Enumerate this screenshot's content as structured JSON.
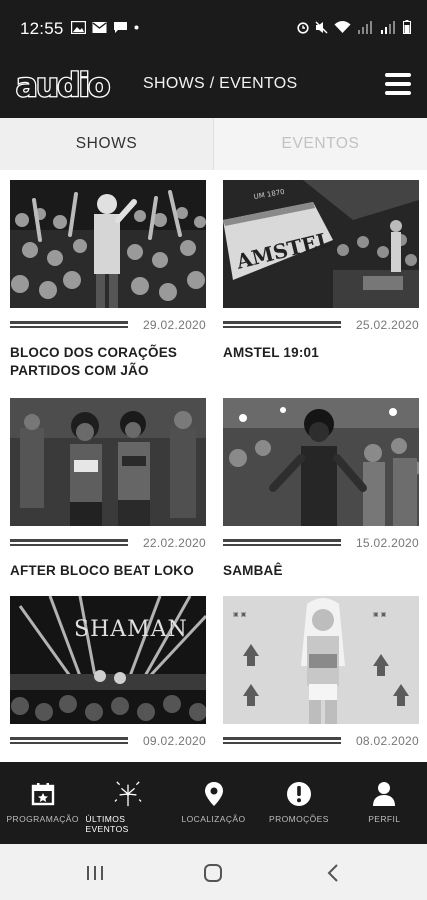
{
  "status_bar": {
    "time": "12:55"
  },
  "header": {
    "logo": "audio",
    "title": "SHOWS / EVENTOS"
  },
  "tabs": [
    {
      "label": "SHOWS",
      "active": true
    },
    {
      "label": "EVENTOS",
      "active": false
    }
  ],
  "cards": [
    {
      "date": "29.02.2020",
      "title": "BLOCO DOS CORAÇÕES PARTIDOS COM JÃO"
    },
    {
      "date": "25.02.2020",
      "title": "AMSTEL 19:01",
      "image_text": {
        "brand": "AMSTEL",
        "sign": "UM 1870"
      }
    },
    {
      "date": "22.02.2020",
      "title": "AFTER BLOCO BEAT LOKO"
    },
    {
      "date": "15.02.2020",
      "title": "SAMBAÊ"
    },
    {
      "date": "09.02.2020",
      "title": "",
      "image_text": {
        "sign": "SHAMAN"
      }
    },
    {
      "date": "08.02.2020",
      "title": ""
    }
  ],
  "bottom_nav": [
    {
      "label": "PROGRAMAÇÃO",
      "icon": "calendar-star-icon",
      "active": false
    },
    {
      "label": "ÚLTIMOS EVENTOS",
      "icon": "fireworks-icon",
      "active": true
    },
    {
      "label": "LOCALIZAÇÃO",
      "icon": "map-pin-icon",
      "active": false
    },
    {
      "label": "PROMOÇÕES",
      "icon": "alert-badge-icon",
      "active": false
    },
    {
      "label": "PERFIL",
      "icon": "person-icon",
      "active": false
    }
  ],
  "colors": {
    "bar_bg": "#1b1b1b",
    "tab_bg": "#efefef",
    "accent": "#ffffff"
  }
}
